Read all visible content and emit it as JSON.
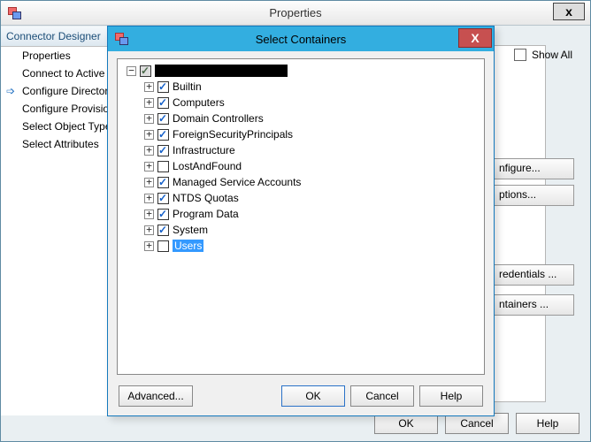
{
  "parent": {
    "title": "Properties",
    "close_glyph": "x",
    "buttons": {
      "ok": "OK",
      "cancel": "Cancel",
      "help": "Help"
    }
  },
  "designer": {
    "header": "Connector Designer",
    "items": [
      {
        "label": "Properties",
        "active": false
      },
      {
        "label": "Connect to Active Directory Forest",
        "active": false
      },
      {
        "label": "Configure Directory Partitions",
        "active": true
      },
      {
        "label": "Configure Provisioning Hierarchy",
        "active": false
      },
      {
        "label": "Select Object Types",
        "active": false
      },
      {
        "label": "Select Attributes",
        "active": false
      }
    ]
  },
  "right_panel": {
    "show_all": "Show All",
    "btn_configure": "nfigure...",
    "btn_options": "ptions...",
    "btn_credentials": "redentials ...",
    "btn_containers": "ntainers ..."
  },
  "modal": {
    "title": "Select Containers",
    "close_glyph": "X",
    "advanced": "Advanced...",
    "ok": "OK",
    "cancel": "Cancel",
    "help": "Help"
  },
  "tree": {
    "root": {
      "expanded": true,
      "checked": "tri",
      "redacted": true
    },
    "children": [
      {
        "label": "Builtin",
        "checked": true,
        "expandable": true,
        "selected": false
      },
      {
        "label": "Computers",
        "checked": true,
        "expandable": true,
        "selected": false
      },
      {
        "label": "Domain Controllers",
        "checked": true,
        "expandable": true,
        "selected": false
      },
      {
        "label": "ForeignSecurityPrincipals",
        "checked": true,
        "expandable": true,
        "selected": false
      },
      {
        "label": "Infrastructure",
        "checked": true,
        "expandable": true,
        "selected": false
      },
      {
        "label": "LostAndFound",
        "checked": false,
        "expandable": true,
        "selected": false
      },
      {
        "label": "Managed Service Accounts",
        "checked": true,
        "expandable": true,
        "selected": false
      },
      {
        "label": "NTDS Quotas",
        "checked": true,
        "expandable": true,
        "selected": false
      },
      {
        "label": "Program Data",
        "checked": true,
        "expandable": true,
        "selected": false
      },
      {
        "label": "System",
        "checked": true,
        "expandable": true,
        "selected": false
      },
      {
        "label": "Users",
        "checked": false,
        "expandable": true,
        "selected": true
      }
    ]
  }
}
